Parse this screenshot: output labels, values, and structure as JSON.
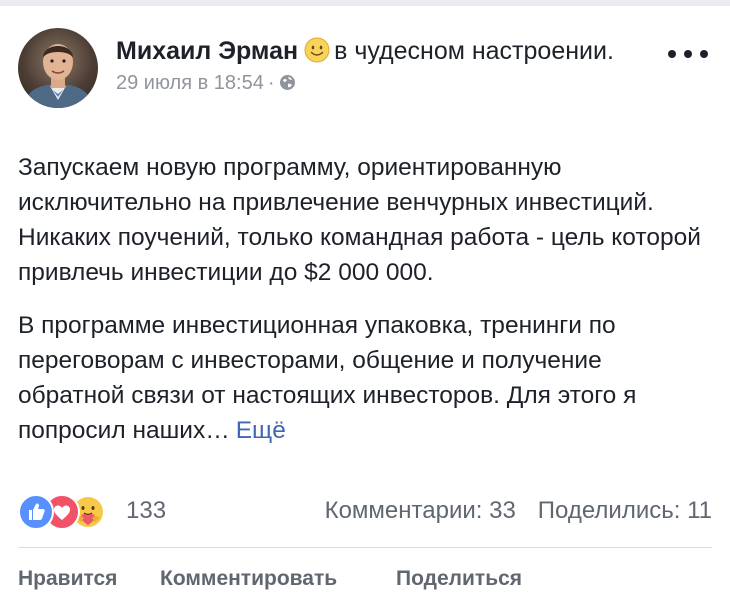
{
  "post": {
    "author": "Михаил Эрман",
    "feeling_text": "в чудесном настроении.",
    "feeling_icon": "smiling-face-emoji",
    "timestamp": "29 июля в 18:54",
    "separator": "·",
    "privacy_icon": "globe-icon",
    "more_icon": "more-options-icon",
    "paragraphs": [
      "Запускаем новую программу, ориентированную исключительно на привлечение венчурных инвестиций. Никаких поучений, только командная работа - цель которой привлечь инвестиции до $2 000 000.",
      "В программе инвестиционная упаковка, тренинги по переговорам с инвесторами, общение и получение обратной связи от настоящих инвесторов. Для этого я попросил наших…"
    ],
    "see_more": "Ещё"
  },
  "reactions": {
    "icons": [
      "like-reaction-icon",
      "love-reaction-icon",
      "care-reaction-icon"
    ],
    "count": "133",
    "comments": "Комментарии: 33",
    "shares": "Поделились: 11"
  },
  "actions": {
    "like": "Нравится",
    "comment": "Комментировать",
    "share": "Поделиться"
  },
  "colors": {
    "link": "#4267b2",
    "muted": "#90949c",
    "like_blue": "#5890ff",
    "love_red": "#f25268"
  }
}
